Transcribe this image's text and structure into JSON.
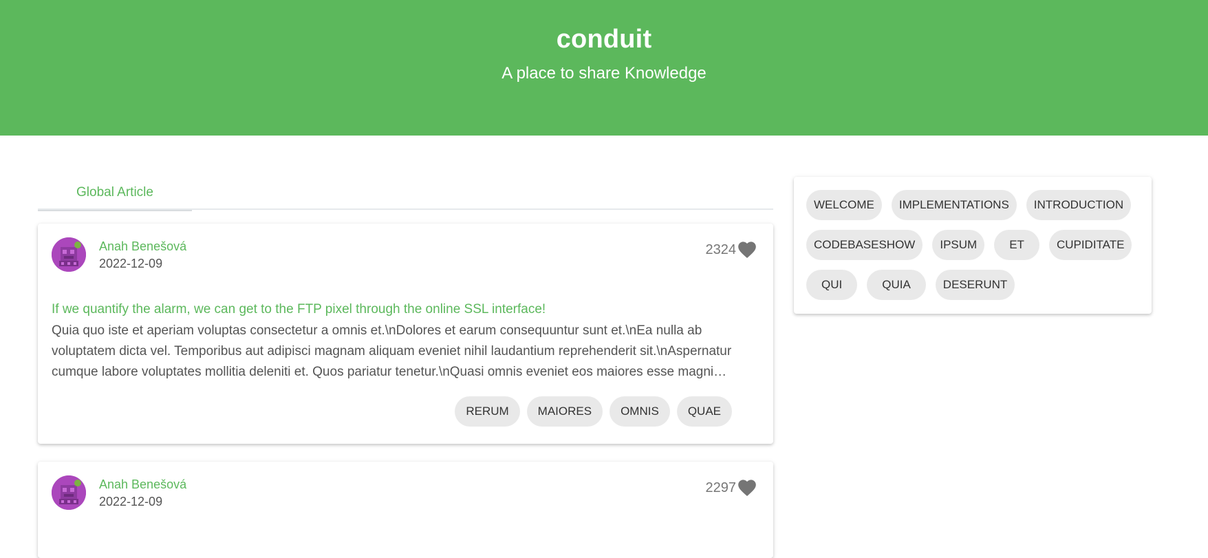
{
  "hero": {
    "title": "conduit",
    "subtitle": "A place to share Knowledge"
  },
  "tabs": [
    {
      "label": "Global Article",
      "active": true
    }
  ],
  "articles": [
    {
      "author": "Anah Benešová",
      "date": "2022-12-09",
      "likes": "2324",
      "title": "If we quantify the alarm, we can get to the FTP pixel through the online SSL interface!",
      "body": "Quia quo iste et aperiam voluptas consectetur a omnis et.\\nDolores et earum consequuntur sunt et.\\nEa nulla ab voluptatem dicta vel. Temporibus aut adipisci magnam aliquam eveniet nihil laudantium reprehenderit sit.\\nAspernatur cumque labore voluptates mollitia deleniti et. Quos pariatur tenetur.\\nQuasi omnis eveniet eos maiores esse magni possimus blanditiis.",
      "tags": [
        "RERUM",
        "MAIORES",
        "OMNIS",
        "QUAE"
      ]
    },
    {
      "author": "Anah Benešová",
      "date": "2022-12-09",
      "likes": "2297"
    }
  ],
  "popular_tags": [
    [
      "WELCOME",
      "IMPLEMENTATIONS",
      "INTRODUCTION"
    ],
    [
      "CODEBASESHOW",
      "IPSUM",
      "ET",
      "CUPIDITATE"
    ],
    [
      "QUI",
      "QUIA",
      "DESERUNT"
    ]
  ],
  "icons": {
    "like": "heart-icon",
    "avatar": "user-avatar"
  },
  "colors": {
    "brand": "#5cb85c",
    "chip": "#e9e9e9",
    "avatar": "#ab47bc"
  }
}
